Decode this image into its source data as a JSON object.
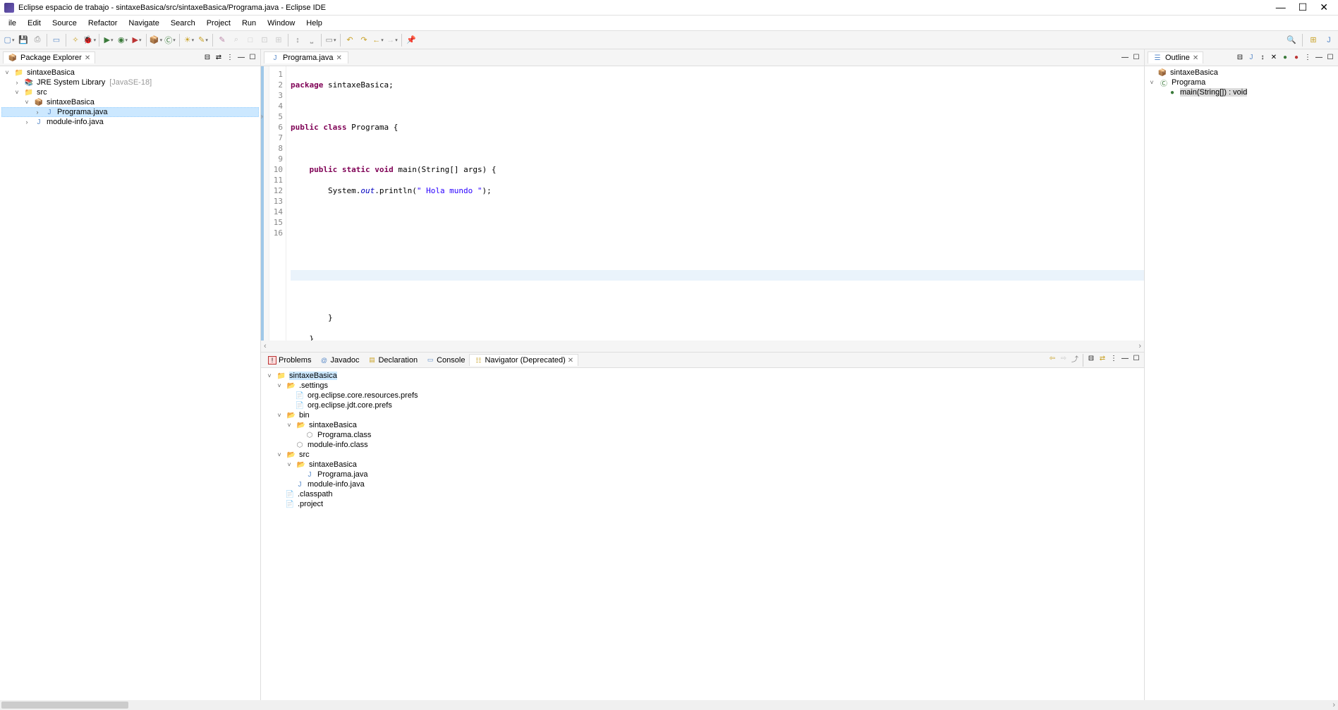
{
  "titlebar": {
    "text": "Eclipse espacio de trabajo - sintaxeBasica/src/sintaxeBasica/Programa.java - Eclipse IDE"
  },
  "menubar": [
    "ile",
    "Edit",
    "Source",
    "Refactor",
    "Navigate",
    "Search",
    "Project",
    "Run",
    "Window",
    "Help"
  ],
  "leftPanel": {
    "title": "Package Explorer",
    "tree": {
      "project": "sintaxeBasica",
      "jre": "JRE System Library",
      "jreDecor": "[JavaSE-18]",
      "src": "src",
      "pkg": "sintaxeBasica",
      "file1": "Programa.java",
      "file2": "module-info.java"
    }
  },
  "editor": {
    "tab": "Programa.java",
    "lines": [
      "1",
      "2",
      "3",
      "4",
      "5",
      "6",
      "7",
      "8",
      "9",
      "10",
      "11",
      "12",
      "13",
      "14",
      "15",
      "16"
    ],
    "code": {
      "l1a": "package",
      "l1b": " sintaxeBasica;",
      "l3a": "public",
      "l3b": " ",
      "l3c": "class",
      "l3d": " Programa {",
      "l5a": "public",
      "l5b": " ",
      "l5c": "static",
      "l5d": " ",
      "l5e": "void",
      "l5f": " main(String[] args) {",
      "l6a": "        System.",
      "l6b": "out",
      "l6c": ".println(",
      "l6d": "\" Hola mundo \"",
      "l6e": ");",
      "l12": "        }",
      "l13": "    }"
    }
  },
  "bottomTabs": {
    "problems": "Problems",
    "javadoc": "Javadoc",
    "declaration": "Declaration",
    "console": "Console",
    "navigator": "Navigator (Deprecated)"
  },
  "navigator": {
    "root": "sintaxeBasica",
    "settings": ".settings",
    "prefs1": "org.eclipse.core.resources.prefs",
    "prefs2": "org.eclipse.jdt.core.prefs",
    "bin": "bin",
    "binPkg": "sintaxeBasica",
    "class1": "Programa.class",
    "class2": "module-info.class",
    "src": "src",
    "srcPkg": "sintaxeBasica",
    "java1": "Programa.java",
    "java2": "module-info.java",
    "classpath": ".classpath",
    "project": ".project"
  },
  "outline": {
    "title": "Outline",
    "pkg": "sintaxeBasica",
    "class": "Programa",
    "method": "main(String[]) : void"
  }
}
